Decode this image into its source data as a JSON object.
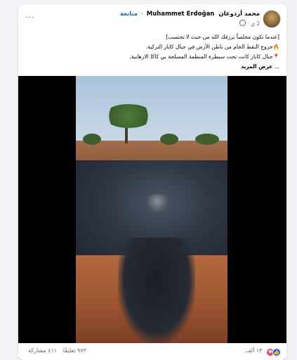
{
  "post": {
    "author_name": "Muhammet Erdoğan",
    "author_name_ar": "محمد أردوغان",
    "separator": "·",
    "follow_label": "متابعة",
    "time": "2 ي",
    "privacy_icon": "globe-icon",
    "more_icon": "more-options-icon",
    "more_label": "···",
    "text_lines": [
      "[عندما تكون مخلصاً يرزقك الله من حيث لا تحتسب]",
      "🔥خروج النفط الخام من باطن الأرض في جبال كابار التركية.",
      "📍جبال كابار كانت تحت سيطرة المنظمة المسلحة بي كاكا الارهابية."
    ],
    "see_more_prefix": "... ",
    "see_more_label": "عرض المزيد"
  },
  "reactions": {
    "like_icon": "like-icon",
    "love_icon": "love-icon",
    "count": "١٣ ألف",
    "comments": "٩٧٣ تعليقًا",
    "shares": "٤١١ مشاركة"
  },
  "colors": {
    "accent": "#0866ff",
    "background": "#f0f2f5",
    "card": "#ffffff",
    "secondary_text": "#65676b"
  }
}
